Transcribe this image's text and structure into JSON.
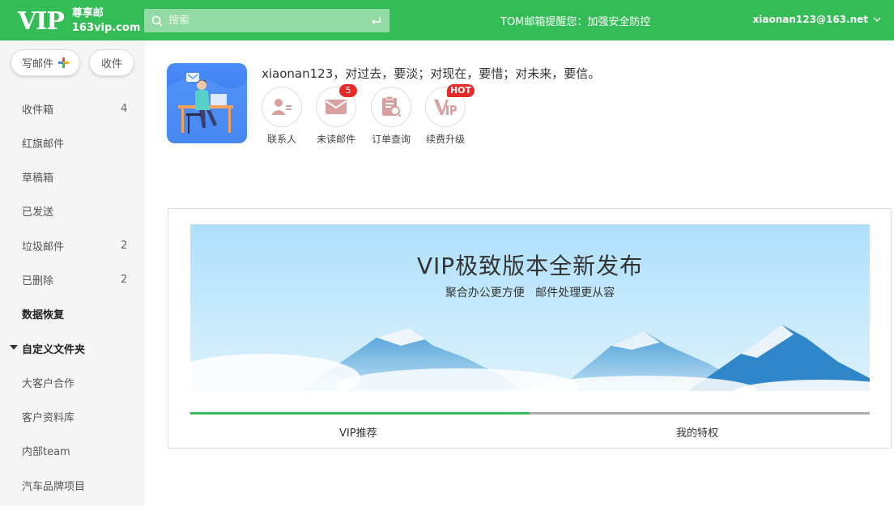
{
  "header": {
    "logo_vip": "VIP",
    "logo_cn": "尊享邮",
    "logo_domain": "163vip.com",
    "search_placeholder": "搜索",
    "notice": "TOM邮箱提醒您：加强安全防控",
    "account": "xiaonan123@163.net"
  },
  "sidebar": {
    "compose_label": "写邮件",
    "receive_label": "收件",
    "folders": [
      {
        "label": "收件箱",
        "count": "4"
      },
      {
        "label": "红旗邮件",
        "count": ""
      },
      {
        "label": "草稿箱",
        "count": ""
      },
      {
        "label": "已发送",
        "count": ""
      },
      {
        "label": "垃圾邮件",
        "count": "2"
      },
      {
        "label": "已删除",
        "count": "2"
      },
      {
        "label": "数据恢复",
        "count": ""
      }
    ],
    "custom_header": "自定义文件夹",
    "custom_folders": [
      "大客户合作",
      "客户资料库",
      "内部team",
      "汽车品牌项目"
    ]
  },
  "profile": {
    "motto": "xiaonan123，对过去，要淡；对现在，要惜；对未来，要信。",
    "quick_links": [
      {
        "label": "联系人",
        "icon": "contacts-icon",
        "badge": ""
      },
      {
        "label": "未读邮件",
        "icon": "mail-icon",
        "badge": "5"
      },
      {
        "label": "订单查询",
        "icon": "order-icon",
        "badge": ""
      },
      {
        "label": "续费升级",
        "icon": "vip-icon",
        "badge": "HOT"
      }
    ]
  },
  "banner": {
    "title": "VIP极致版本全新发布",
    "subtitle": "聚合办公更方便   邮件处理更从容",
    "tabs": [
      "VIP推荐",
      "我的特权"
    ]
  },
  "colors": {
    "brand_green": "#34bc56",
    "badge_red": "#e52a2a"
  }
}
